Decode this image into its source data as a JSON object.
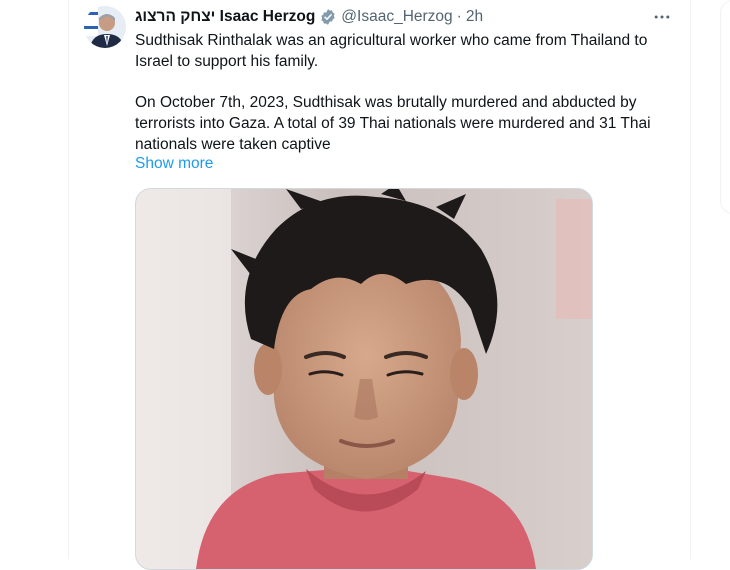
{
  "tweet": {
    "author": {
      "display_name": "יצחק הרצוג Isaac Herzog",
      "handle": "@Isaac_Herzog",
      "verified_icon": "verified-badge-icon",
      "avatar_icon": "avatar"
    },
    "separator": "·",
    "time": "2h",
    "more_icon": "more-options-icon",
    "paragraphs": [
      "Sudthisak Rinthalak was an agricultural worker who came from Thailand to Israel to support his family.",
      "On October 7th, 2023, Sudthisak was brutally murdered and abducted by terrorists into Gaza. A total of 39 Thai nationals were murdered and 31 Thai nationals were taken captive"
    ],
    "show_more": "Show more",
    "media": {
      "kind": "photo",
      "description_icon": "portrait-photo"
    }
  },
  "colors": {
    "text": "#0f1419",
    "secondary": "#536471",
    "link": "#1d9bf0",
    "border": "#cfd9de"
  }
}
